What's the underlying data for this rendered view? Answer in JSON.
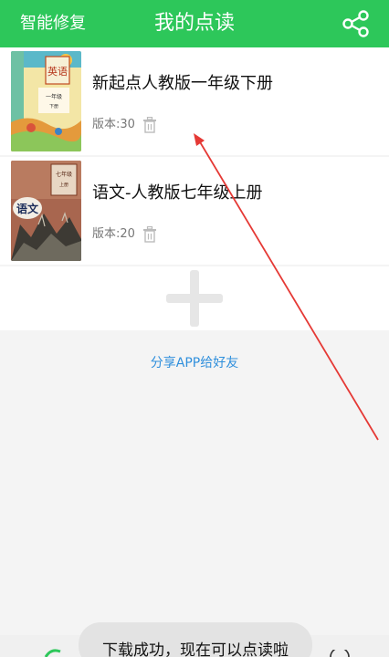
{
  "header": {
    "left_button": "智能修复",
    "title": "我的点读",
    "share_icon": "share-icon"
  },
  "books": [
    {
      "name": "新起点人教版一年级下册",
      "version": "版本:30",
      "cover_label": "英语",
      "cover_sublabel": "一年级",
      "cover_sublabel2": "下册"
    },
    {
      "name": "语文-人教版七年级上册",
      "version": "版本:20",
      "cover_label": "语文",
      "cover_sublabel": "七年级",
      "cover_sublabel2": "上册"
    }
  ],
  "share_link": "分享APP给好友",
  "toast": "下载成功，现在可以点读啦",
  "colors": {
    "accent": "#2dc75a",
    "link": "#2f8fdc",
    "annotation_arrow": "#e53935"
  }
}
